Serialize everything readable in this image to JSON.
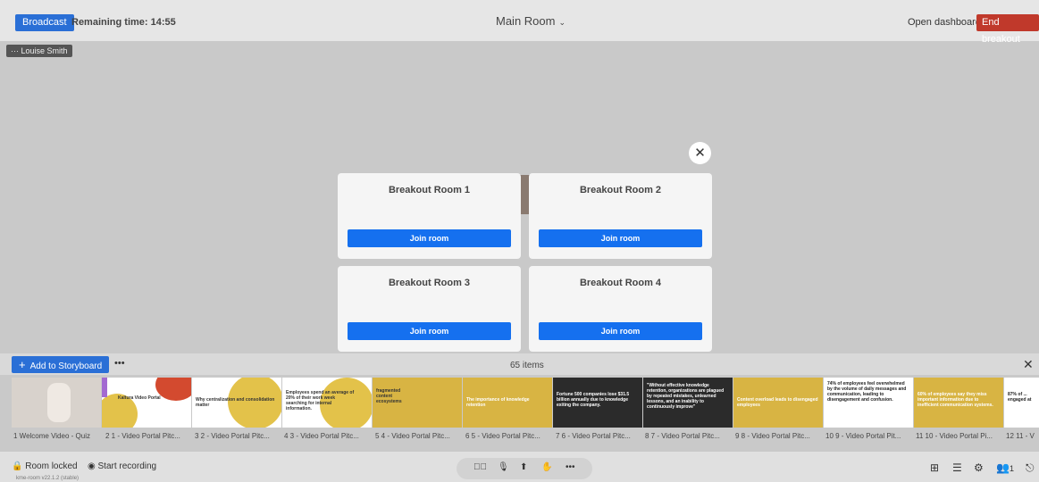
{
  "topbar": {
    "broadcast": "Broadcast",
    "remaining": "Remaining time: 14:55",
    "room_title": "Main Room",
    "open_dashboard": "Open dashboard",
    "end_breakout": "End breakout"
  },
  "name_tag": "··· Louise Smith",
  "modal": {
    "close": "✕",
    "rooms": [
      {
        "title": "Breakout Room 1",
        "join": "Join room"
      },
      {
        "title": "Breakout Room 2",
        "join": "Join room"
      },
      {
        "title": "Breakout Room 3",
        "join": "Join room"
      },
      {
        "title": "Breakout Room 4",
        "join": "Join room"
      }
    ]
  },
  "storyboard": {
    "add": "Add to Storyboard",
    "more": "•••",
    "count": "65 items",
    "close": "✕",
    "thumbs": [
      {
        "text": ""
      },
      {
        "text": "Kaltura Video Portal"
      },
      {
        "text": "Why centralization and consolidation matter"
      },
      {
        "text": "Employees spend an average of 20% of their work week searching for internal information."
      },
      {
        "text": "fragmented content ecosystems"
      },
      {
        "text": "The importance of knowledge retention"
      },
      {
        "text": "Fortune 500 companies lose $31.5 billion annually due to knowledge exiting the company."
      },
      {
        "text": "\"Without effective knowledge retention, organizations are plagued by repeated mistakes, unlearned lessons, and an inability to continuously improve\""
      },
      {
        "text": "Content overload leads to disengaged employees"
      },
      {
        "text": "74% of employees feel overwhelmed by the volume of daily messages and communication, leading to disengagement and confusion."
      },
      {
        "text": "60% of employees say they miss important information due to inefficient communication systems."
      },
      {
        "text": "87% of ... engaged at"
      }
    ],
    "labels": [
      "1 Welcome Video - Quiz",
      "2 1 - Video Portal Pitc...",
      "3 2 - Video Portal Pitc...",
      "4 3 - Video Portal Pitc...",
      "5 4 - Video Portal Pitc...",
      "6 5 - Video Portal Pitc...",
      "7 6 - Video Portal Pitc...",
      "8 7 - Video Portal Pitc...",
      "9 8 - Video Portal Pitc...",
      "10 9 - Video Portal Pit...",
      "11 10 - Video Portal Pi...",
      "12 11 - V"
    ]
  },
  "bottombar": {
    "room_locked": "Room locked",
    "start_recording": "Start recording",
    "version": "kme-room v22.1.2 (stable)",
    "participants_count": "1"
  },
  "colors": {
    "accent_blue": "#1570ef",
    "end_red": "#c0392b",
    "slide_yellow": "#d8b443",
    "slide_dark": "#2b2b2b"
  }
}
